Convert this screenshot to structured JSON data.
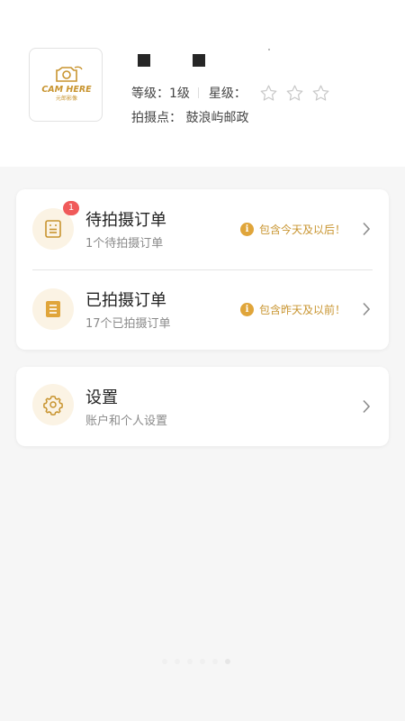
{
  "profile": {
    "logo_text": "CAM HERE",
    "logo_subtext": "元郎影像",
    "level_label": "等级：",
    "level_value": "1级",
    "stars_label": "星级：",
    "stars_value": 0,
    "stars_max": 3,
    "spot_label": "拍摄点：",
    "spot_value": "鼓浪屿邮政"
  },
  "orders": [
    {
      "title": "待拍摄订单",
      "subtitle": "1个待拍摄订单",
      "badge": "1",
      "notice": "包含今天及以后！",
      "icon": "clipboard-list-icon"
    },
    {
      "title": "已拍摄订单",
      "subtitle": "17个已拍摄订单",
      "notice": "包含昨天及以前！",
      "icon": "clipboard-done-icon"
    }
  ],
  "settings": {
    "title": "设置",
    "subtitle": "账户和个人设置",
    "icon": "gear-icon"
  },
  "colors": {
    "accent": "#e0a53a",
    "badge": "#f05a5a",
    "icon_bg": "#fbf3e4"
  }
}
